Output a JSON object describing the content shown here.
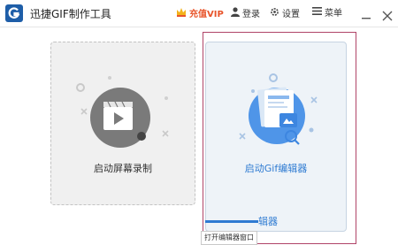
{
  "window": {
    "title": "迅捷GIF制作工具",
    "logo_letter": "G"
  },
  "toolbar": {
    "vip_label": "充值VIP",
    "login_label": "登录",
    "settings_label": "设置",
    "menu_label": "菜单"
  },
  "cards": {
    "screen_record_label": "启动屏幕录制",
    "gif_editor_label": "启动Gif编辑器"
  },
  "partial_label": "辑器",
  "tooltip": "打开编辑器窗口",
  "colors": {
    "accent": "#2f7bd2",
    "vip": "#e8542a",
    "logo": "#1e5ea8"
  }
}
